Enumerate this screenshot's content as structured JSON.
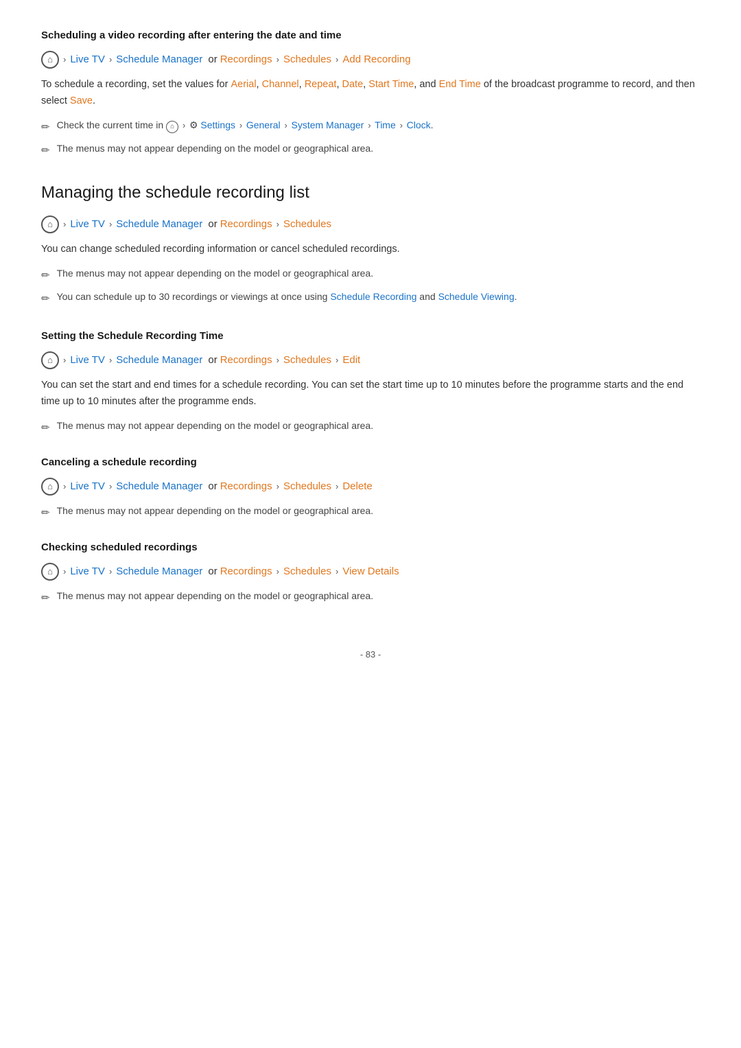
{
  "page": {
    "number": "- 83 -"
  },
  "section1": {
    "title": "Scheduling a video recording after entering the date and time",
    "nav": {
      "home_icon": "⌂",
      "items": [
        {
          "text": "Live TV",
          "type": "blue"
        },
        {
          "text": "Schedule Manager",
          "type": "blue"
        },
        {
          "text": "or",
          "type": "plain"
        },
        {
          "text": "Recordings",
          "type": "orange"
        },
        {
          "text": "Schedules",
          "type": "orange"
        },
        {
          "text": "Add Recording",
          "type": "orange"
        }
      ]
    },
    "body": "To schedule a recording, set the values for Aerial, Channel, Repeat, Date, Start Time, and End Time of the broadcast programme to record, and then select Save.",
    "inline_links": [
      "Aerial",
      "Channel",
      "Repeat",
      "Date",
      "Start Time",
      "End Time",
      "Save"
    ],
    "note1_prefix": "Check the current time in",
    "note1_settings": "Settings",
    "note1_path": "General > System Manager > Time > Clock",
    "note2": "The menus may not appear depending on the model or geographical area."
  },
  "section2": {
    "title": "Managing the schedule recording list",
    "nav": {
      "items": [
        {
          "text": "Live TV",
          "type": "blue"
        },
        {
          "text": "Schedule Manager",
          "type": "blue"
        },
        {
          "text": "or",
          "type": "plain"
        },
        {
          "text": "Recordings",
          "type": "orange"
        },
        {
          "text": "Schedules",
          "type": "orange"
        }
      ]
    },
    "body": "You can change scheduled recording information or cancel scheduled recordings.",
    "note1": "The menus may not appear depending on the model or geographical area.",
    "note2_prefix": "You can schedule up to 30 recordings or viewings at once using",
    "note2_link1": "Schedule Recording",
    "note2_and": "and",
    "note2_link2": "Schedule Viewing",
    "note2_suffix": "."
  },
  "section3": {
    "title": "Setting the Schedule Recording Time",
    "nav": {
      "items": [
        {
          "text": "Live TV",
          "type": "blue"
        },
        {
          "text": "Schedule Manager",
          "type": "blue"
        },
        {
          "text": "or",
          "type": "plain"
        },
        {
          "text": "Recordings",
          "type": "orange"
        },
        {
          "text": "Schedules",
          "type": "orange"
        },
        {
          "text": "Edit",
          "type": "orange"
        }
      ]
    },
    "body": "You can set the start and end times for a schedule recording. You can set the start time up to 10 minutes before the programme starts and the end time up to 10 minutes after the programme ends.",
    "note1": "The menus may not appear depending on the model or geographical area."
  },
  "section4": {
    "title": "Canceling a schedule recording",
    "nav": {
      "items": [
        {
          "text": "Live TV",
          "type": "blue"
        },
        {
          "text": "Schedule Manager",
          "type": "blue"
        },
        {
          "text": "or",
          "type": "plain"
        },
        {
          "text": "Recordings",
          "type": "orange"
        },
        {
          "text": "Schedules",
          "type": "orange"
        },
        {
          "text": "Delete",
          "type": "orange"
        }
      ]
    },
    "note1": "The menus may not appear depending on the model or geographical area."
  },
  "section5": {
    "title": "Checking scheduled recordings",
    "nav": {
      "items": [
        {
          "text": "Live TV",
          "type": "blue"
        },
        {
          "text": "Schedule Manager",
          "type": "blue"
        },
        {
          "text": "or",
          "type": "plain"
        },
        {
          "text": "Recordings",
          "type": "orange"
        },
        {
          "text": "Schedules",
          "type": "orange"
        },
        {
          "text": "View Details",
          "type": "orange"
        }
      ]
    },
    "note1": "The menus may not appear depending on the model or geographical area."
  },
  "labels": {
    "chevron": "›",
    "pencil_icon": "✏",
    "or_text": "or"
  }
}
